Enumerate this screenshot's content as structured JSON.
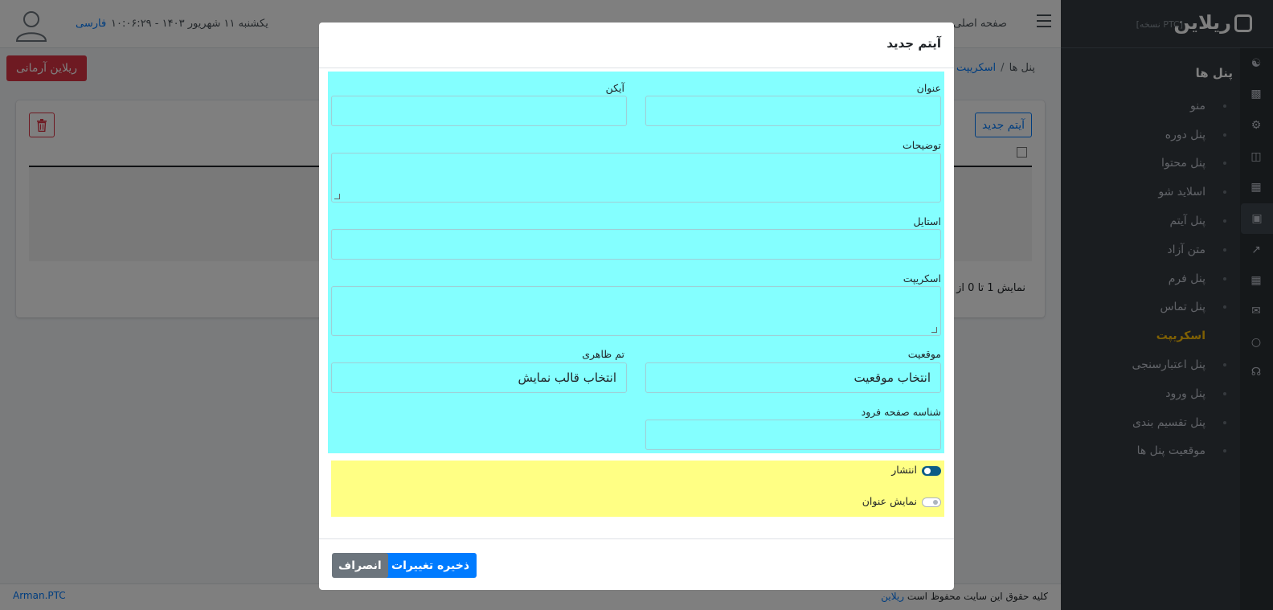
{
  "sidebar": {
    "brand": "ریلاین",
    "version": "[PTC نسخه]",
    "title": "پنل ها",
    "items": [
      {
        "label": "منو",
        "icon": "users-icon"
      },
      {
        "label": "پنل دوره",
        "icon": "monitor-icon"
      },
      {
        "label": "پنل محتوا",
        "icon": "gear-icon"
      },
      {
        "label": "اسلاید شو",
        "icon": "basket-icon"
      },
      {
        "label": "پنل آیتم",
        "icon": "table-icon"
      },
      {
        "label": "متن آزاد",
        "icon": "image-icon"
      },
      {
        "label": "پنل فرم",
        "icon": "chart-line-icon"
      },
      {
        "label": "پنل تماس",
        "icon": "calculator-icon"
      },
      {
        "label": "اسکریپت",
        "icon": "envelope-icon",
        "active": true
      },
      {
        "label": "پنل اعتبارسنجی",
        "icon": "comment-icon"
      },
      {
        "label": "پنل ورود",
        "icon": "headset-icon"
      },
      {
        "label": "پنل تقسیم بندی"
      },
      {
        "label": "موقعیت پنل ها"
      }
    ]
  },
  "topbar": {
    "language": "فارسی",
    "datetime": "یکشنبه ۱۱ شهریور ۱۴۰۳ - ۱۰:۰۶:۲۹",
    "home": "صفحه اصلی"
  },
  "breadbar": {
    "brand_button": "ریلاین آرمانی",
    "crumb_root": "پنل ها",
    "crumb_current": "اسکریپت"
  },
  "card": {
    "new_button": "آیتم جدید",
    "paging": "نمایش 1 تا 0 از 0"
  },
  "footer": {
    "copyright": "کلیه حقوق این سایت محفوظ است",
    "brand_link": "ریلاین",
    "left_link": "Arman.PTC"
  },
  "modal": {
    "title": "آیتم جدید",
    "fields": {
      "title_label": "عنوان",
      "icon_label": "آیکن",
      "description_label": "توضیحات",
      "style_label": "استایل",
      "script_label": "اسکریپت",
      "position_label": "موقعیت",
      "position_value": "انتخاب موقعیت",
      "theme_label": "تم ظاهری",
      "theme_value": "انتخاب قالب نمایش",
      "landing_label": "شناسه صفحه فرود"
    },
    "switches": {
      "publish_label": "انتشار",
      "publish_on": true,
      "show_title_label": "نمایش عنوان",
      "show_title_on": false
    },
    "save_button": "ذخیره تغییرات",
    "cancel_button": "انصراف",
    "colors": {
      "form_area": "#84ffff",
      "switch_area": "#ffff84",
      "primary": "#007bff"
    }
  }
}
